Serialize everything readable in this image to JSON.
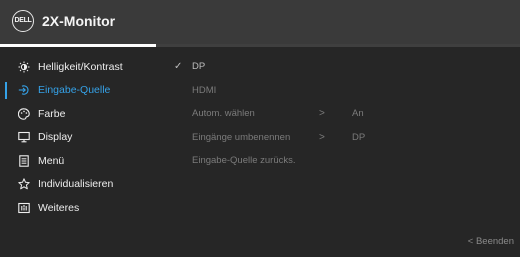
{
  "header": {
    "logo": "DELL",
    "title": "2X-Monitor"
  },
  "progress": {
    "fraction": 0.3
  },
  "menu": {
    "items": [
      {
        "icon": "brightness-icon",
        "label": "Helligkeit/Kontrast"
      },
      {
        "icon": "input-source-icon",
        "label": "Eingabe-Quelle",
        "active": true
      },
      {
        "icon": "color-icon",
        "label": "Farbe"
      },
      {
        "icon": "display-icon",
        "label": "Display"
      },
      {
        "icon": "menu-icon",
        "label": "Menü"
      },
      {
        "icon": "star-icon",
        "label": "Individualisieren"
      },
      {
        "icon": "others-icon",
        "label": "Weiteres"
      }
    ]
  },
  "submenu": {
    "items": [
      {
        "label": "DP",
        "checked": true
      },
      {
        "label": "HDMI"
      },
      {
        "label": "Autom. wählen",
        "arrow": ">",
        "value": "An"
      },
      {
        "label": "Eingänge umbenennen",
        "arrow": ">",
        "value": "DP"
      },
      {
        "label": "Eingabe-Quelle zurücks."
      }
    ]
  },
  "footer": {
    "exit_label": "< Beenden"
  },
  "colors": {
    "accent": "#35a2e8",
    "background": "#262626",
    "header": "#3a3a3a"
  }
}
